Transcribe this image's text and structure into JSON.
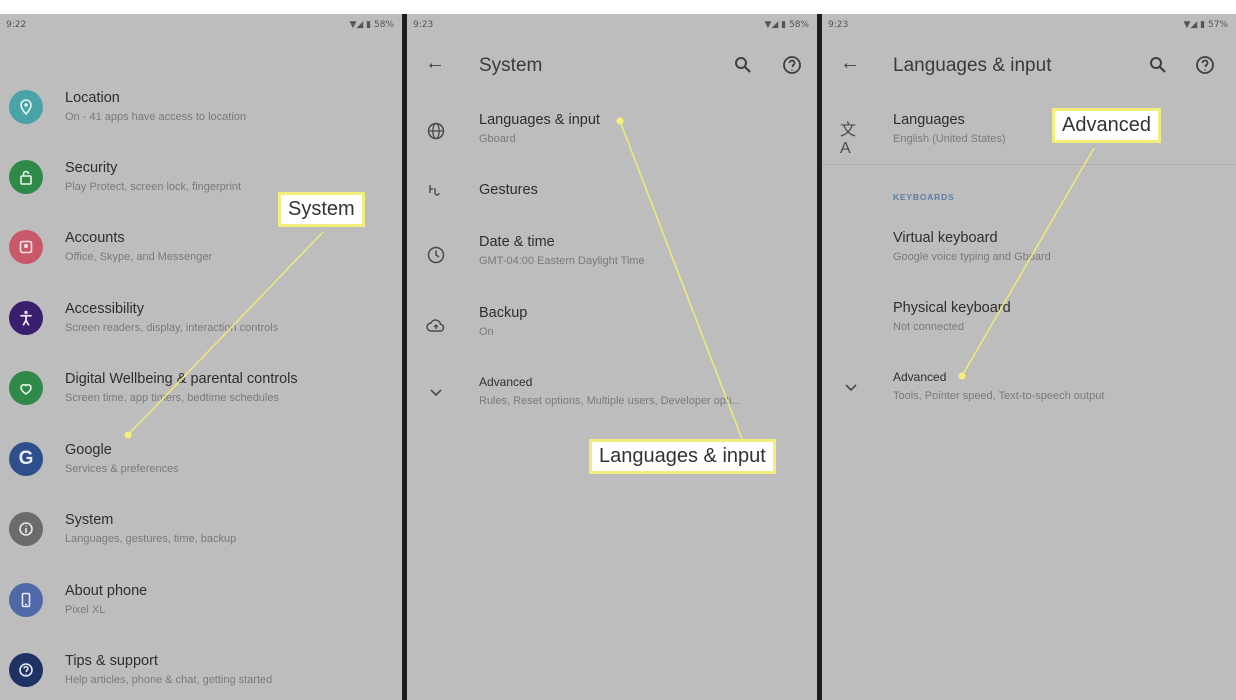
{
  "panels": [
    {
      "status": {
        "time": "9:22",
        "battery": "58%"
      },
      "items": [
        {
          "title": "Location",
          "subtitle": "On - 41 apps have access to location",
          "color": "#4aa3a6",
          "icon": "location-icon"
        },
        {
          "title": "Security",
          "subtitle": "Play Protect, screen lock, fingerprint",
          "color": "#2f8a4a",
          "icon": "lock-icon"
        },
        {
          "title": "Accounts",
          "subtitle": "Office, Skype, and Messenger",
          "color": "#c9596a",
          "icon": "account-icon"
        },
        {
          "title": "Accessibility",
          "subtitle": "Screen readers, display, interaction controls",
          "color": "#3a1f6e",
          "icon": "accessibility-icon"
        },
        {
          "title": "Digital Wellbeing & parental controls",
          "subtitle": "Screen time, app timers, bedtime schedules",
          "color": "#2f8a4a",
          "icon": "wellbeing-icon"
        },
        {
          "title": "Google",
          "subtitle": "Services & preferences",
          "color": "#2e4f8c",
          "icon": "google-icon"
        },
        {
          "title": "System",
          "subtitle": "Languages, gestures, time, backup",
          "color": "#6b6b6b",
          "icon": "info-icon"
        },
        {
          "title": "About phone",
          "subtitle": "Pixel XL",
          "color": "#4f68a8",
          "icon": "phone-icon"
        },
        {
          "title": "Tips & support",
          "subtitle": "Help articles, phone & chat, getting started",
          "color": "#1e3264",
          "icon": "help-icon"
        }
      ],
      "callout": "System"
    },
    {
      "status": {
        "time": "9:23",
        "battery": "58%"
      },
      "title": "System",
      "items": [
        {
          "title": "Languages & input",
          "subtitle": "Gboard",
          "icon": "globe-icon"
        },
        {
          "title": "Gestures",
          "subtitle": "",
          "icon": "gestures-icon"
        },
        {
          "title": "Date & time",
          "subtitle": "GMT-04:00 Eastern Daylight Time",
          "icon": "clock-icon"
        },
        {
          "title": "Backup",
          "subtitle": "On",
          "icon": "cloud-backup-icon"
        },
        {
          "title": "Advanced",
          "subtitle": "Rules, Reset options, Multiple users, Developer opti...",
          "icon": "chevron-down-icon"
        }
      ],
      "callout": "Languages & input"
    },
    {
      "status": {
        "time": "9:23",
        "battery": "57%"
      },
      "title": "Languages & input",
      "items": [
        {
          "title": "Languages",
          "subtitle": "English (United States)",
          "icon": "translate-icon"
        }
      ],
      "section": "KEYBOARDS",
      "keyboard_items": [
        {
          "title": "Virtual keyboard",
          "subtitle": "Google voice typing and Gboard"
        },
        {
          "title": "Physical keyboard",
          "subtitle": "Not connected"
        },
        {
          "title": "Advanced",
          "subtitle": "Tools, Pointer speed, Text-to-speech output"
        }
      ],
      "callout": "Advanced"
    }
  ]
}
